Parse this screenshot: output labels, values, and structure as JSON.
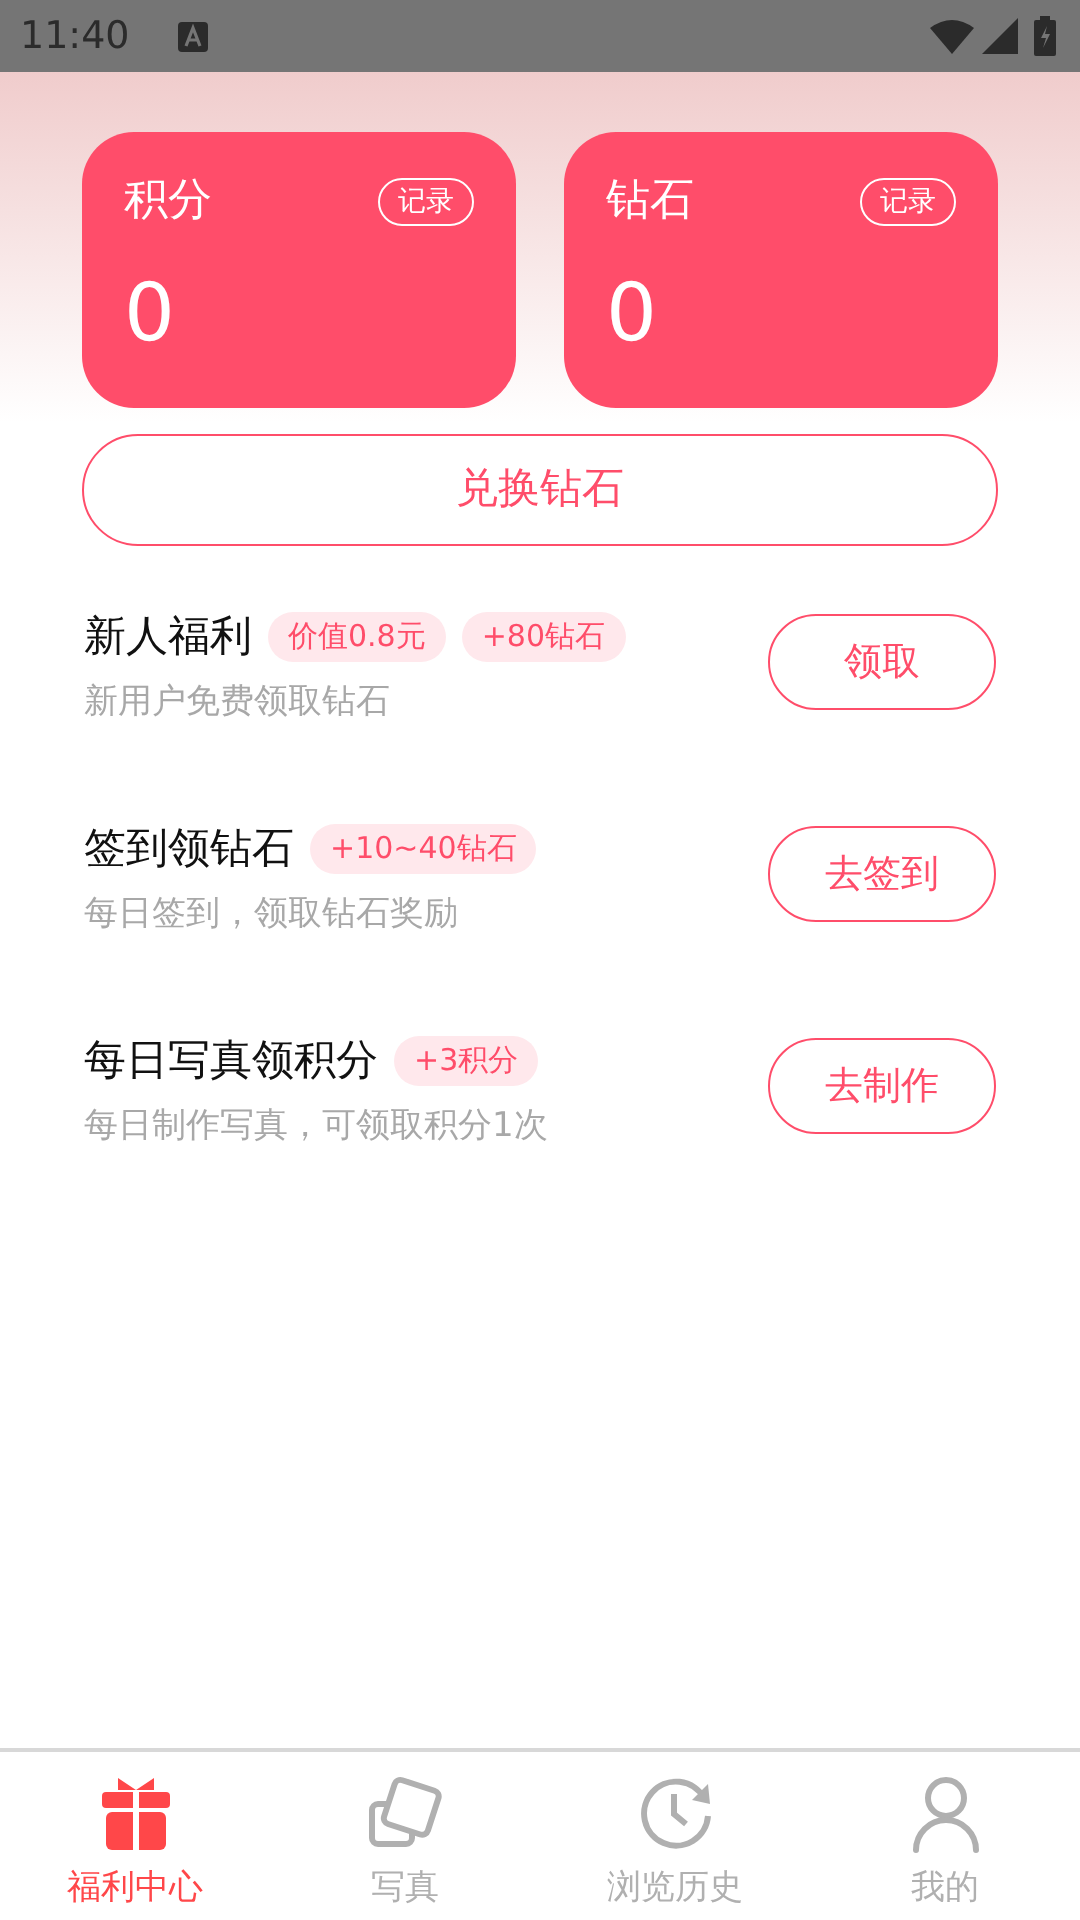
{
  "status_bar": {
    "time": "11:40"
  },
  "balances": [
    {
      "label": "积分",
      "value": "0",
      "record": "记录"
    },
    {
      "label": "钻石",
      "value": "0",
      "record": "记录"
    }
  ],
  "exchange_button": "兑换钻石",
  "tasks": [
    {
      "title": "新人福利",
      "tags": [
        "价值0.8元",
        "+80钻石"
      ],
      "description": "新用户免费领取钻石",
      "action": "领取"
    },
    {
      "title": "签到领钻石",
      "tags": [
        "+10~40钻石"
      ],
      "description": "每日签到，领取钻石奖励",
      "action": "去签到"
    },
    {
      "title": "每日写真领积分",
      "tags": [
        "+3积分"
      ],
      "description": "每日制作写真，可领取积分1次",
      "action": "去制作"
    }
  ],
  "tab_bar": [
    {
      "label": "福利中心",
      "kind": "gift",
      "selected": true
    },
    {
      "label": "写真",
      "kind": "photos",
      "selected": false
    },
    {
      "label": "浏览历史",
      "kind": "history",
      "selected": false
    },
    {
      "label": "我的",
      "kind": "profile",
      "selected": false
    }
  ]
}
